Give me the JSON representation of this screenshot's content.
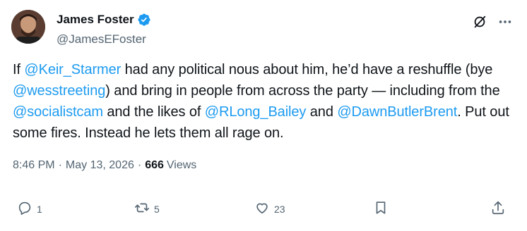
{
  "author": {
    "display_name": "James Foster",
    "handle": "@JamesEFoster"
  },
  "tweet": {
    "segments": [
      {
        "text": "If ",
        "type": "text"
      },
      {
        "text": "@Keir_Starmer",
        "type": "mention"
      },
      {
        "text": " had any political nous about him, he’d have a reshuffle (bye ",
        "type": "text"
      },
      {
        "text": "@wesstreeting",
        "type": "mention"
      },
      {
        "text": ") and bring in people from across the party — including from the ",
        "type": "text"
      },
      {
        "text": "@socialistcam",
        "type": "mention"
      },
      {
        "text": " and the likes of ",
        "type": "text"
      },
      {
        "text": "@RLong_Bailey",
        "type": "mention"
      },
      {
        "text": " and ",
        "type": "text"
      },
      {
        "text": "@DawnButlerBrent",
        "type": "mention"
      },
      {
        "text": ". Put out some fires. Instead he lets them all rage on.",
        "type": "text"
      }
    ]
  },
  "meta": {
    "time": "8:46 PM",
    "separator": "·",
    "date": "May 13, 2026",
    "views_count": "666",
    "views_label": "Views"
  },
  "actions": {
    "replies": "1",
    "reposts": "5",
    "likes": "23"
  },
  "icons": [
    "verified-badge-icon",
    "grok-icon",
    "more-icon",
    "reply-icon",
    "repost-icon",
    "like-icon",
    "bookmark-icon",
    "share-icon"
  ],
  "colors": {
    "accent": "#1d9bf0",
    "text": "#0f1419",
    "muted": "#536471"
  }
}
